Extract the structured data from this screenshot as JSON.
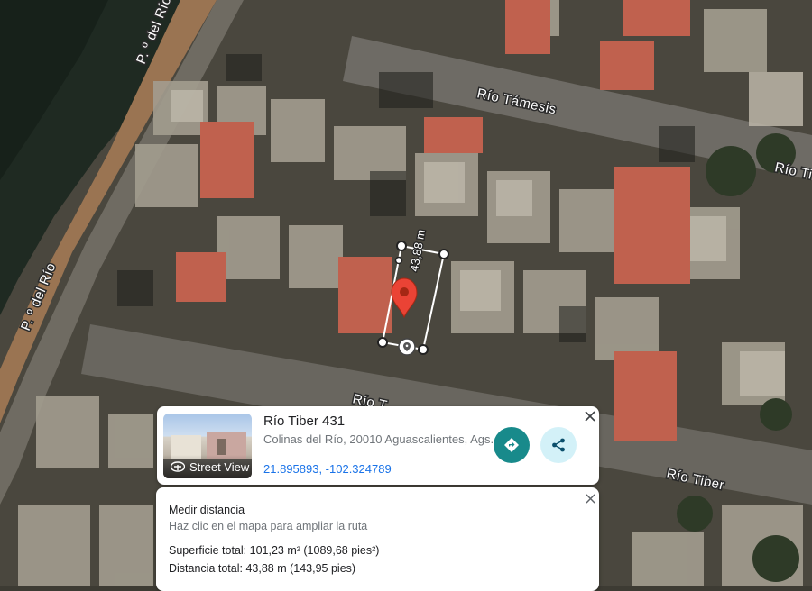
{
  "map": {
    "streets": [
      {
        "id": "street-label-p-del-rio-top",
        "name": "P. º del Río"
      },
      {
        "id": "street-label-rio-tamesis",
        "name": "Río Támesis"
      },
      {
        "id": "street-label-rio-ti-right",
        "name": "Río Ti"
      },
      {
        "id": "street-label-p-del-rio-left",
        "name": "P. º del Río"
      },
      {
        "id": "street-label-rio-tiber-mid",
        "name": "Río T"
      },
      {
        "id": "street-label-rio-tiber-right",
        "name": "Río Tiber"
      }
    ],
    "measurement_label": "43,88 m",
    "marker_color": "#ea4335",
    "measure_line_color": "#ffffff"
  },
  "place_card": {
    "title": "Río Tiber 431",
    "address": "Colinas del Río, 20010 Aguascalientes, Ags.",
    "coordinates": "21.895893, -102.324789",
    "street_view_label": "Street View",
    "accent_color": "#188a8b",
    "share_bg": "#d3f1f8",
    "icons": [
      "street-view-icon",
      "directions-icon",
      "share-icon",
      "close-icon"
    ]
  },
  "measure_card": {
    "title": "Medir distancia",
    "hint": "Haz clic en el mapa para ampliar la ruta",
    "area": "Superficie total: 101,23 m² (1089,68 pies²)",
    "distance": "Distancia total: 43,88 m (143,95 pies)"
  }
}
